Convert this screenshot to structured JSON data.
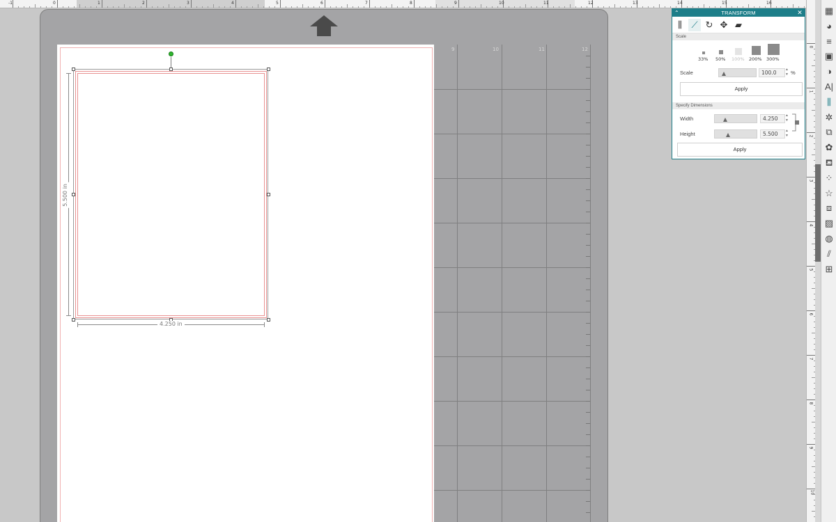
{
  "top_ruler": {
    "labels": [
      "-1",
      "0",
      "1",
      "2",
      "3",
      "4",
      "5",
      "6",
      "7",
      "8",
      "9",
      "10",
      "11",
      "12",
      "13",
      "14",
      "15",
      "16"
    ]
  },
  "right_ruler": {
    "labels": [
      "0",
      "1",
      "2",
      "3",
      "4",
      "5",
      "6",
      "7",
      "8",
      "9",
      "10"
    ]
  },
  "toolbar": {
    "tools": [
      {
        "name": "page-setup-icon",
        "glyph": "▦"
      },
      {
        "name": "fill-panel-icon",
        "glyph": "◕"
      },
      {
        "name": "line-style-icon",
        "glyph": "≡"
      },
      {
        "name": "shadow-icon",
        "glyph": "▣"
      },
      {
        "name": "image-effects-icon",
        "glyph": "◑"
      },
      {
        "name": "text-style-icon",
        "glyph": "A|"
      },
      {
        "name": "transform-icon",
        "glyph": "⫼"
      },
      {
        "name": "replicate-icon",
        "glyph": "✲"
      },
      {
        "name": "modify-icon",
        "glyph": "⧉"
      },
      {
        "name": "offset-icon",
        "glyph": "✿"
      },
      {
        "name": "trace-icon",
        "glyph": "⛾"
      },
      {
        "name": "sketch-icon",
        "glyph": "⁘"
      },
      {
        "name": "library-icon",
        "glyph": "☆"
      },
      {
        "name": "send-icon",
        "glyph": "⧈"
      },
      {
        "name": "pattern-icon",
        "glyph": "▨"
      },
      {
        "name": "rhinestone-icon",
        "glyph": "◍"
      },
      {
        "name": "print-then-cut-icon",
        "glyph": "⫽"
      },
      {
        "name": "warp-icon",
        "glyph": "⊞"
      }
    ]
  },
  "mat": {
    "grid_numbers": [
      "9",
      "10",
      "11",
      "12"
    ]
  },
  "selection": {
    "width_label": "4.250 in",
    "height_label": "5.500 in"
  },
  "panel": {
    "title": "TRANSFORM",
    "collapse_glyph": "⌃",
    "close_glyph": "✕",
    "tabs": [
      {
        "name": "align-tab",
        "glyph": "⫼"
      },
      {
        "name": "scale-tab",
        "glyph": "⟋"
      },
      {
        "name": "rotate-tab",
        "glyph": "↻"
      },
      {
        "name": "move-tab",
        "glyph": "✥"
      },
      {
        "name": "shear-tab",
        "glyph": "▰"
      }
    ],
    "scale_section": "Scale",
    "presets": [
      "33%",
      "50%",
      "100%",
      "200%",
      "300%"
    ],
    "scale_label": "Scale",
    "scale_value": "100.0",
    "scale_unit": "%",
    "apply1": "Apply",
    "dims_section": "Specify Dimensions",
    "width_label": "Width",
    "width_value": "4.250",
    "height_label": "Height",
    "height_value": "5.500",
    "apply2": "Apply",
    "spin_up": "▲",
    "spin_down": "▼"
  },
  "colors": {
    "accent": "#1d7e89",
    "mat": "#a4a4a6",
    "cut_line": "#e89090",
    "rotate_handle": "#2fb52f"
  }
}
